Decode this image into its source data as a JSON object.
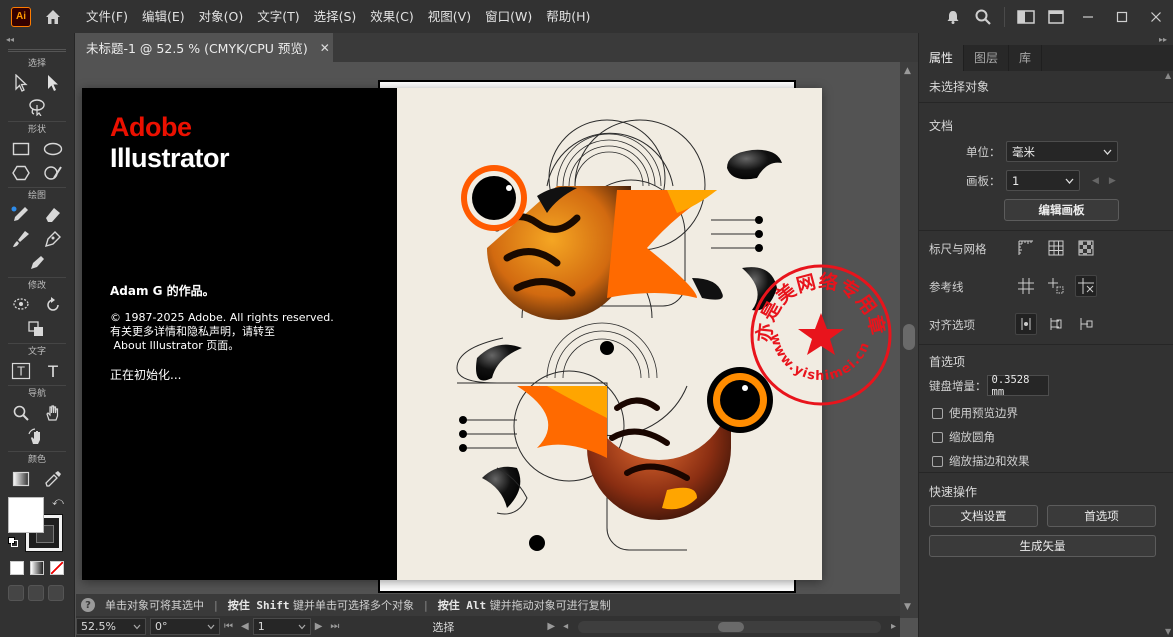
{
  "app": {
    "logo_text": "Ai"
  },
  "menu": [
    "文件(F)",
    "编辑(E)",
    "对象(O)",
    "文字(T)",
    "选择(S)",
    "效果(C)",
    "视图(V)",
    "窗口(W)",
    "帮助(H)"
  ],
  "toolbar": {
    "labels": {
      "select": "选择",
      "shape": "形状",
      "draw": "绘图",
      "modify": "修改",
      "type": "文字",
      "nav": "导航",
      "color": "颜色"
    }
  },
  "document": {
    "tab_title": "未标题-1 @ 52.5 % (CMYK/CPU 预览)"
  },
  "splash": {
    "brand_top": "Adobe",
    "brand_product": "Illustrator",
    "author": "Adam G 的作品。",
    "copyright_line1": "© 1987-2025 Adobe. All rights reserved.",
    "copyright_line2": "有关更多详情和隐私声明，请转至",
    "copyright_line3": " About Illustrator 页面。",
    "status": "正在初始化..."
  },
  "watermark": {
    "arc_text": "亦是美网络专用章",
    "url_text": "www.yishimei.cn",
    "color": "#e8141c"
  },
  "hint": {
    "part1": "单击对象可将其选中",
    "key1": "按住 Shift",
    "part2": "键并单击可选择多个对象",
    "key2": "按住 Alt",
    "part3": "键并拖动对象可进行复制"
  },
  "status": {
    "zoom": "52.5%",
    "rotation": "0°",
    "artboard": "1",
    "mode": "选择"
  },
  "panel": {
    "tabs": [
      "属性",
      "图层",
      "库"
    ],
    "no_selection": "未选择对象",
    "document_head": "文档",
    "unit_label": "单位：",
    "unit_value": "毫米",
    "artboard_label": "画板：",
    "artboard_value": "1",
    "edit_artboard_btn": "编辑画板",
    "rulers_grids": "标尺与网格",
    "guides": "参考线",
    "snap_options": "对齐选项",
    "preferences": "首选项",
    "keyboard_increment_label": "键盘增量：",
    "keyboard_increment_value": "0.3528 mm",
    "checkbox_preview_bounds": "使用预览边界",
    "checkbox_scale_corners": "缩放圆角",
    "checkbox_scale_strokes": "缩放描边和效果",
    "quick_actions": "快速操作",
    "doc_setup_btn": "文档设置",
    "prefs_btn": "首选项",
    "vectorize_btn": "生成矢量"
  },
  "colors": {
    "accent": "#ff7c00",
    "adobe_red": "#eb1000",
    "ui_dark": "#323232",
    "canvas": "#535353"
  }
}
